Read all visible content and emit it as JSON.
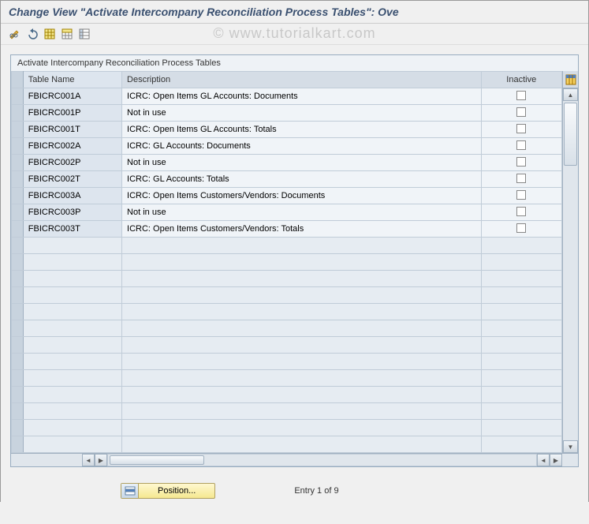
{
  "title": "Change View \"Activate Intercompany Reconciliation Process Tables\": Ove",
  "watermark": "© www.tutorialkart.com",
  "table": {
    "caption": "Activate Intercompany Reconciliation Process Tables",
    "columns": {
      "name": "Table Name",
      "desc": "Description",
      "inactive": "Inactive"
    },
    "rows": [
      {
        "name": "FBICRC001A",
        "desc": "ICRC: Open Items GL Accounts: Documents",
        "inactive": false
      },
      {
        "name": "FBICRC001P",
        "desc": "Not in use",
        "inactive": false
      },
      {
        "name": "FBICRC001T",
        "desc": "ICRC: Open Items GL Accounts: Totals",
        "inactive": false
      },
      {
        "name": "FBICRC002A",
        "desc": "ICRC: GL Accounts: Documents",
        "inactive": false
      },
      {
        "name": "FBICRC002P",
        "desc": "Not in use",
        "inactive": false
      },
      {
        "name": "FBICRC002T",
        "desc": "ICRC: GL Accounts: Totals",
        "inactive": false
      },
      {
        "name": "FBICRC003A",
        "desc": "ICRC: Open Items Customers/Vendors: Documents",
        "inactive": false
      },
      {
        "name": "FBICRC003P",
        "desc": "Not in use",
        "inactive": false
      },
      {
        "name": "FBICRC003T",
        "desc": "ICRC: Open Items Customers/Vendors: Totals",
        "inactive": false
      }
    ],
    "empty_rows": 13
  },
  "footer": {
    "position_label": "Position...",
    "entry_text": "Entry 1 of 9"
  }
}
